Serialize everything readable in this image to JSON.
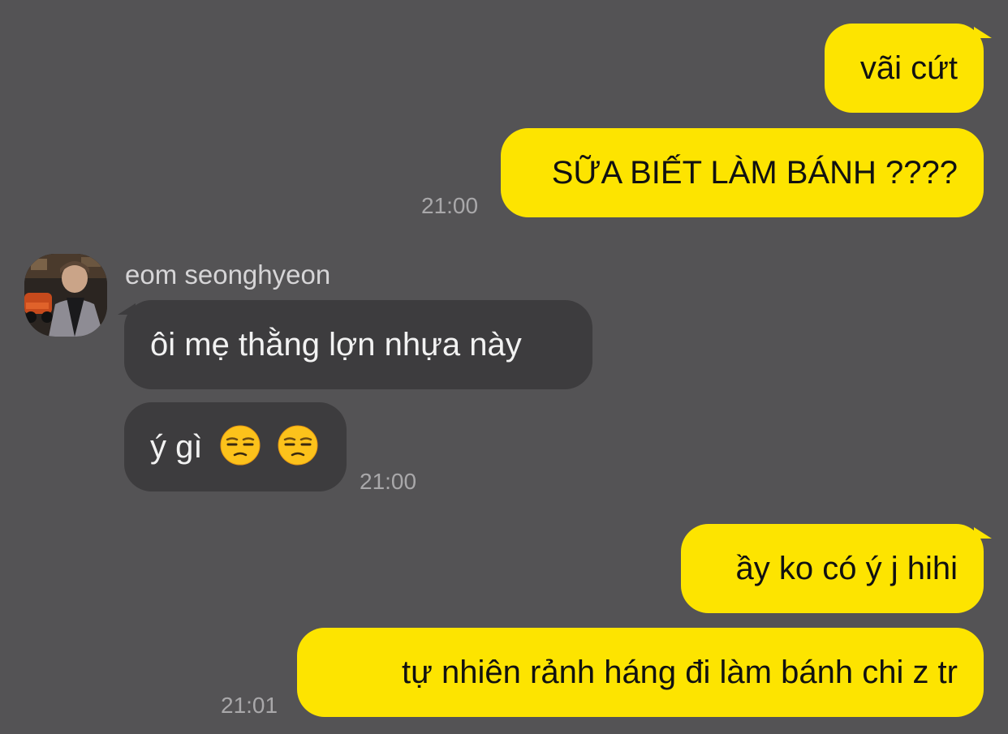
{
  "messages": {
    "m1": {
      "text": "vãi cứt",
      "direction": "outgoing"
    },
    "m2": {
      "text": "SỮA BIẾT LÀM BÁNH ????",
      "direction": "outgoing",
      "time": "21:00"
    },
    "m3": {
      "sender": "eom seonghyeon",
      "text": "ôi mẹ thằng lợn nhựa này",
      "direction": "incoming"
    },
    "m4": {
      "text": "ý gì",
      "emojis": [
        "unamused-face-emoji",
        "unamused-face-emoji"
      ],
      "direction": "incoming",
      "time": "21:00"
    },
    "m5": {
      "text": "ầy ko có ý j hihi",
      "direction": "outgoing"
    },
    "m6": {
      "text": "tự nhiên rảnh háng đi làm bánh chi z tr",
      "direction": "outgoing",
      "time": "21:01"
    }
  },
  "colors": {
    "background": "#545355",
    "outgoing_bubble": "#fde400",
    "incoming_bubble": "#3d3c3e",
    "timestamp": "#a9a8aa"
  }
}
